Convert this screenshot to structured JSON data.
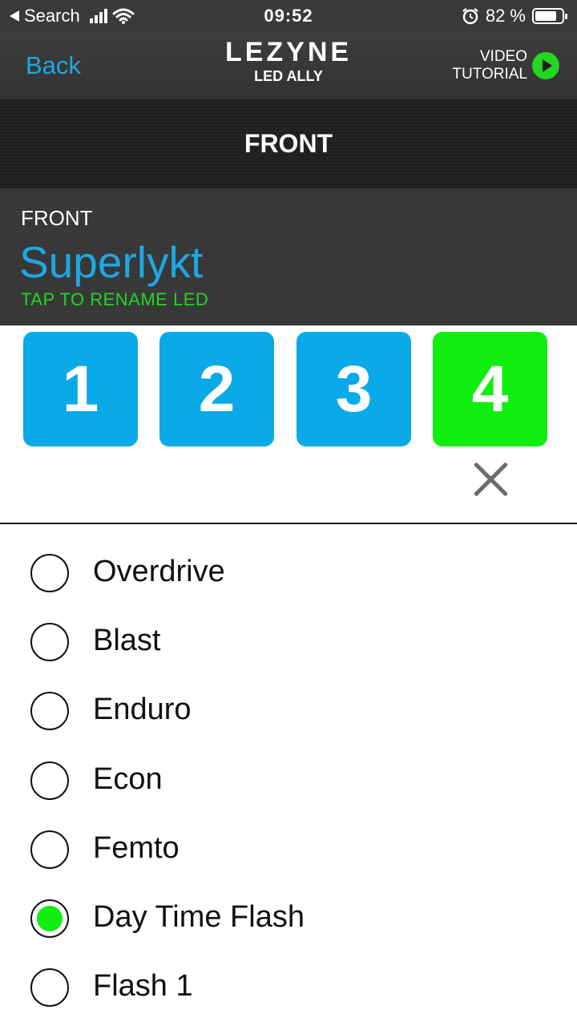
{
  "status_bar": {
    "back_app": "Search",
    "time": "09:52",
    "battery_percent": "82 %",
    "battery_level": 0.82
  },
  "nav": {
    "back_label": "Back",
    "brand_logo": "LEZYNE",
    "brand_sub": "LED ALLY",
    "video_line1": "VIDEO",
    "video_line2": "TUTORIAL"
  },
  "section": {
    "title": "FRONT"
  },
  "led": {
    "position": "FRONT",
    "name": "Superlykt",
    "rename_hint": "TAP TO RENAME LED"
  },
  "modes": [
    {
      "label": "1",
      "color": "#0aa9e8"
    },
    {
      "label": "2",
      "color": "#0aa9e8"
    },
    {
      "label": "3",
      "color": "#0aa9e8"
    },
    {
      "label": "4",
      "color": "#10ee10"
    }
  ],
  "options": [
    {
      "label": "Overdrive",
      "selected": false
    },
    {
      "label": "Blast",
      "selected": false
    },
    {
      "label": "Enduro",
      "selected": false
    },
    {
      "label": "Econ",
      "selected": false
    },
    {
      "label": "Femto",
      "selected": false
    },
    {
      "label": "Day Time Flash",
      "selected": true
    },
    {
      "label": "Flash 1",
      "selected": false
    }
  ],
  "colors": {
    "accent_blue": "#1ea7e4",
    "accent_green": "#22d622"
  },
  "icons": [
    "back-arrow-icon",
    "signal-icon",
    "wifi-icon",
    "alarm-icon",
    "battery-icon",
    "play-icon",
    "close-icon"
  ]
}
